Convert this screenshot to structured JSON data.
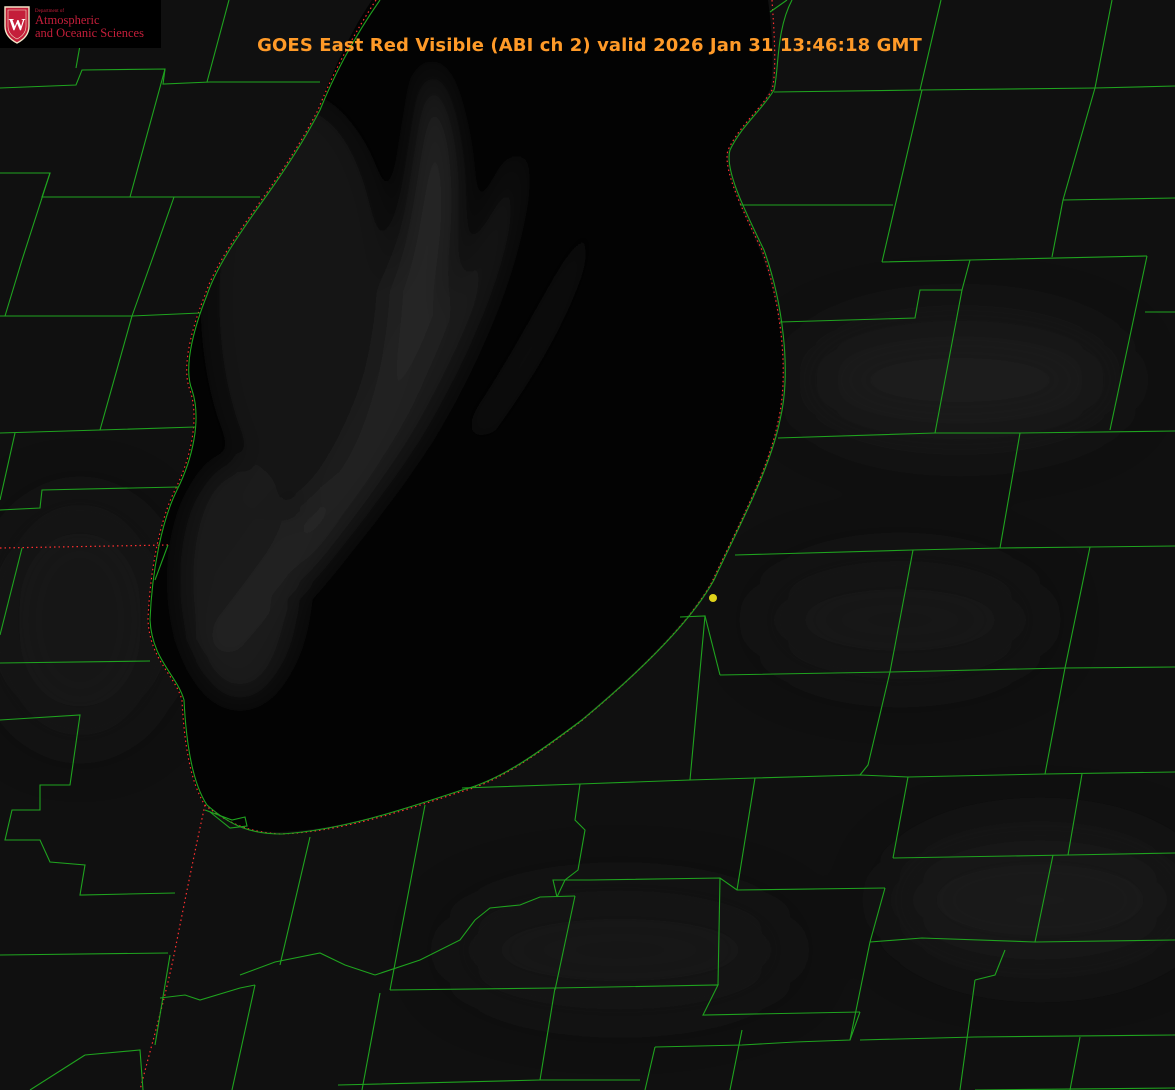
{
  "title": "GOES East Red Visible (ABI ch 2) valid 2026 Jan 31 13:46:18 GMT",
  "logo": {
    "department": "Department of",
    "line1": "Atmospheric",
    "line2": "and Oceanic Sciences",
    "seal_letter": "W"
  },
  "colors": {
    "title": "#ff9a28",
    "county_lines": "#1fa31f",
    "state_border": "#ff3030",
    "marker": "#e0d31a",
    "lake": "#030303",
    "land": "#101010",
    "logo_text": "#c41e3a"
  },
  "layers": [
    "satellite-visible",
    "lake-michigan",
    "county-boundaries",
    "state-boundaries",
    "station-marker"
  ]
}
